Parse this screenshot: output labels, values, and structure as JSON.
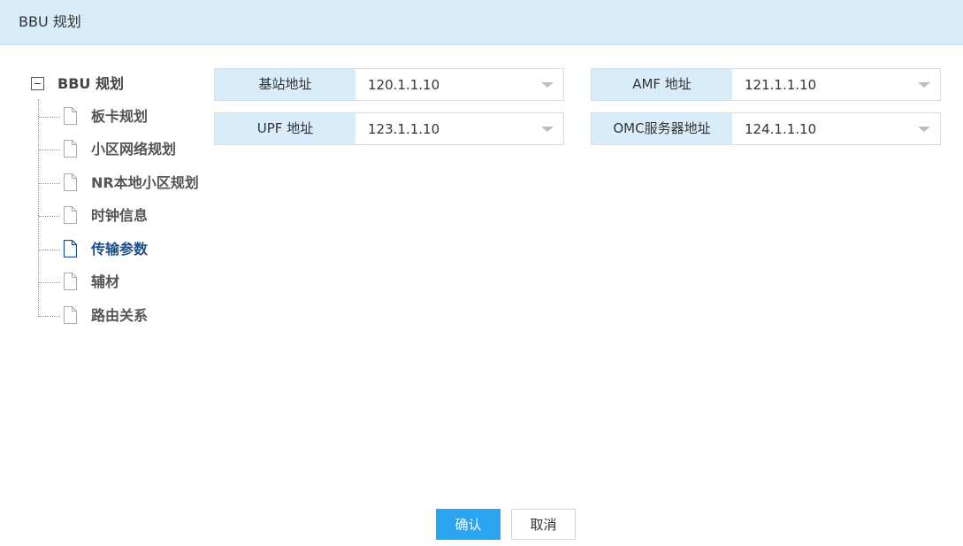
{
  "window": {
    "title": "BBU 规划"
  },
  "tree": {
    "root": {
      "label": "BBU 规划",
      "expanded": true
    },
    "items": [
      {
        "label": "板卡规划",
        "icon": "file-icon",
        "active": false
      },
      {
        "label": "小区网络规划",
        "icon": "file-icon",
        "active": false
      },
      {
        "label": "NR本地小区规划",
        "icon": "file-icon",
        "active": false
      },
      {
        "label": "时钟信息",
        "icon": "file-icon",
        "active": false
      },
      {
        "label": "传输参数",
        "icon": "file-icon",
        "active": true
      },
      {
        "label": "辅材",
        "icon": "file-icon",
        "active": false
      },
      {
        "label": "路由关系",
        "icon": "file-icon",
        "active": false
      }
    ]
  },
  "form": {
    "fields": [
      {
        "label": "基站地址",
        "value": "120.1.1.10"
      },
      {
        "label": "AMF 地址",
        "value": "121.1.1.10"
      },
      {
        "label": "UPF 地址",
        "value": "123.1.1.10"
      },
      {
        "label": "OMC服务器地址",
        "value": "124.1.1.10"
      }
    ]
  },
  "buttons": {
    "confirm": "确认",
    "cancel": "取消"
  },
  "colors": {
    "header_bg": "#d9ecf9",
    "label_bg": "#d9ecf9",
    "primary": "#2aa3f0",
    "active_text": "#1a4f8a"
  }
}
